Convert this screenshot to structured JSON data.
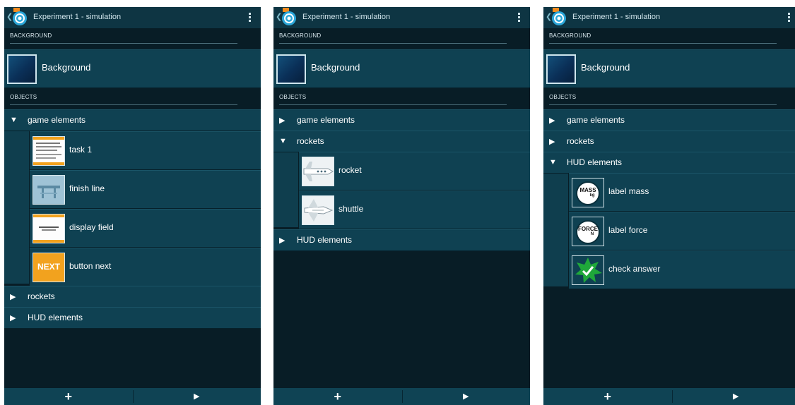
{
  "app": {
    "title": "Experiment 1 - simulation",
    "icon": "pocket-code-app-icon",
    "back_icon": "chevron-left-icon",
    "menu_icon": "more-vert-icon"
  },
  "sections": {
    "background": "BACKGROUND",
    "objects": "OBJECTS"
  },
  "background_item": {
    "label": "Background"
  },
  "groups": [
    "game elements",
    "rockets",
    "HUD elements"
  ],
  "game_elements": [
    {
      "label": "task 1",
      "thumb": "text-slide-thumbnail"
    },
    {
      "label": "finish line",
      "thumb": "finish-line-thumbnail"
    },
    {
      "label": "display field",
      "thumb": "display-field-thumbnail"
    },
    {
      "label": "button next",
      "thumb": "next-button-thumbnail",
      "thumb_text": "NEXT"
    }
  ],
  "rockets": [
    {
      "label": "rocket",
      "thumb": "rocket-thumbnail"
    },
    {
      "label": "shuttle",
      "thumb": "shuttle-thumbnail"
    }
  ],
  "hud_elements": [
    {
      "label": "label mass",
      "thumb_text": "MASS",
      "thumb_unit": "kg"
    },
    {
      "label": "label force",
      "thumb_text": "FORCE",
      "thumb_unit": "N"
    },
    {
      "label": "check answer",
      "thumb": "check-star-thumbnail"
    }
  ],
  "bottom": {
    "add": "+",
    "play": "▶",
    "add_icon": "plus-icon",
    "play_icon": "play-icon"
  },
  "colors": {
    "screen_bg": "#081d26",
    "row_bg": "#0f4152",
    "topbar_bg": "#0e3543",
    "next_button": "#f2a21e",
    "check_star": "#1fa83a"
  },
  "screens": [
    {
      "expanded_group": "game elements"
    },
    {
      "expanded_group": "rockets"
    },
    {
      "expanded_group": "HUD elements"
    }
  ]
}
